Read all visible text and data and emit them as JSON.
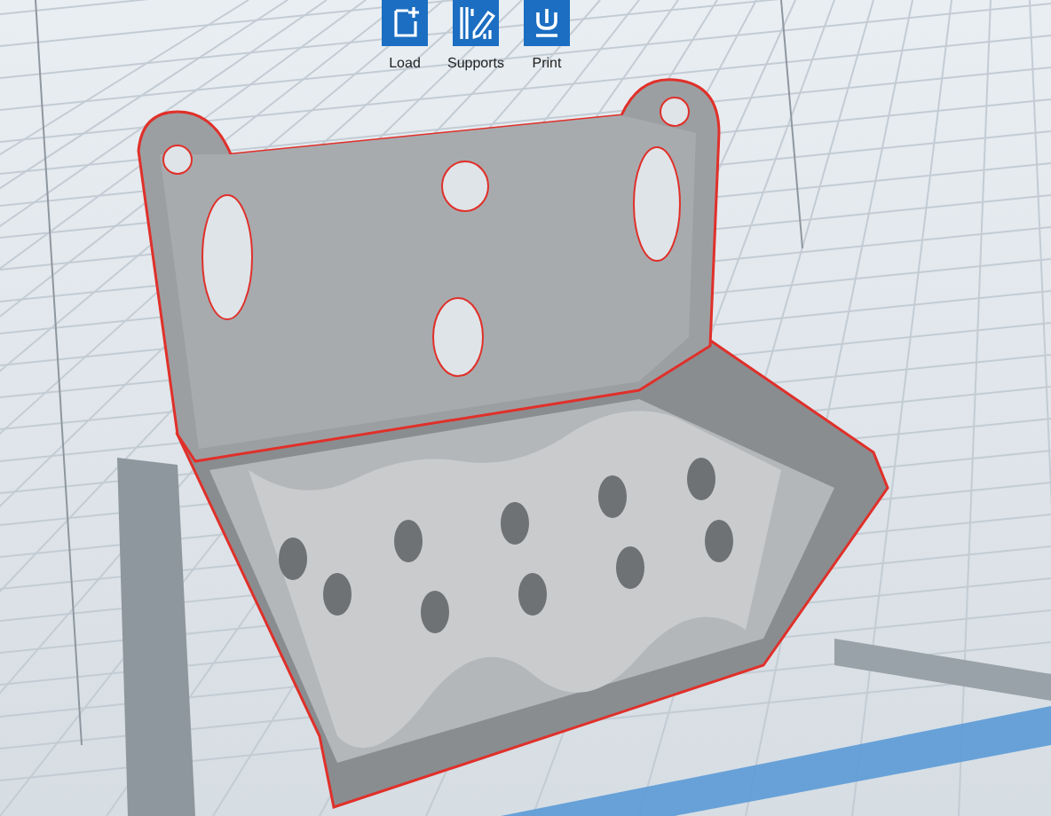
{
  "toolbar": {
    "buttons": [
      {
        "label": "Load",
        "kind": "load"
      },
      {
        "label": "Supports",
        "kind": "supports"
      },
      {
        "label": "Print",
        "kind": "print"
      }
    ]
  }
}
